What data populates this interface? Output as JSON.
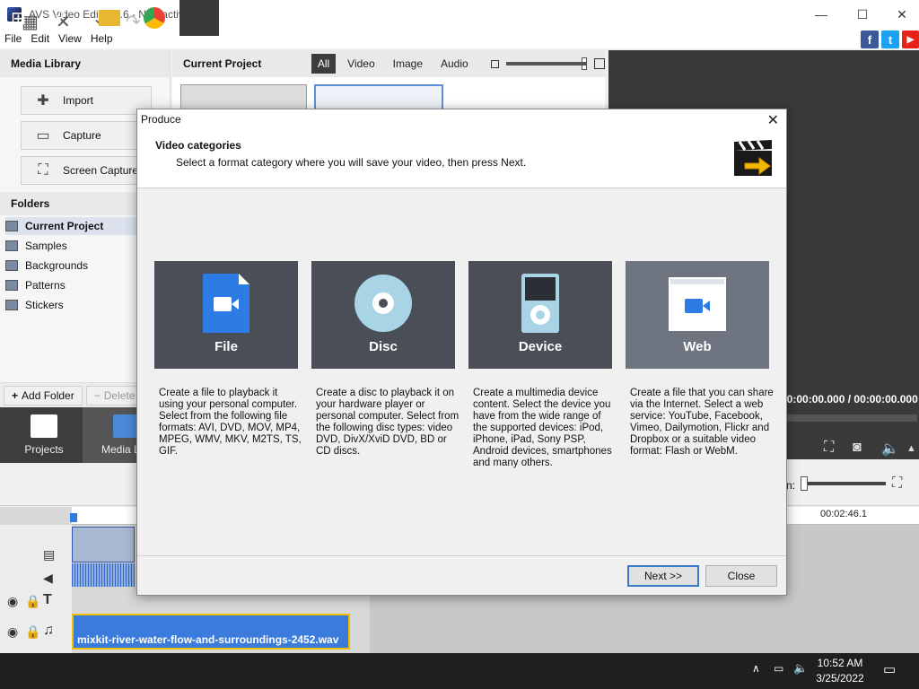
{
  "window": {
    "title": "AVS Video Editor 9.6 - Non-activated",
    "minimize": "—",
    "maximize": "☐",
    "close": "✕"
  },
  "menu": [
    "File",
    "Edit",
    "View",
    "Help"
  ],
  "social": {
    "facebook": "f",
    "twitter": "t",
    "youtube": "▶"
  },
  "media_library": {
    "title": "Media Library",
    "buttons": {
      "import": "Import",
      "capture": "Capture",
      "screen_capture": "Screen Capture"
    },
    "folders_title": "Folders",
    "folders": [
      "Current Project",
      "Samples",
      "Backgrounds",
      "Patterns",
      "Stickers"
    ],
    "add_folder": "Add Folder",
    "delete": "Delete"
  },
  "current_project": {
    "title": "Current Project",
    "filters": [
      "All",
      "Video",
      "Image",
      "Audio"
    ]
  },
  "preview": {
    "time": "00:00:00.000 / 00:00:00.000"
  },
  "nav": {
    "projects": "Projects",
    "media_library": "Media Libr"
  },
  "timeline": {
    "time_marker": "00:02:46.1",
    "zoom_label": "n:",
    "audio_clip": "mixkit-river-water-flow-and-surroundings-2452.wav"
  },
  "taskbar": {
    "time": "10:52 AM",
    "date": "3/25/2022"
  },
  "dialog": {
    "title": "Produce",
    "close": "✕",
    "heading": "Video categories",
    "subheading": "Select a format category where you will save your video, then press Next.",
    "categories": [
      {
        "name": "File",
        "desc": "Create a file to playback it using your personal computer. Select from the following file formats: AVI, DVD, MOV, MP4, MPEG, WMV, MKV, M2TS, TS, GIF."
      },
      {
        "name": "Disc",
        "desc": "Create a disc to playback it on your hardware player or personal computer. Select from the following disc types: video DVD, DivX/XviD DVD, BD or CD discs."
      },
      {
        "name": "Device",
        "desc": "Create a multimedia device content. Select the device you have from the wide range of the supported devices: iPod, iPhone, iPad, Sony PSP, Android devices, smartphones and many others."
      },
      {
        "name": "Web",
        "desc": "Create a file that you can share via the Internet. Select a web service: YouTube, Facebook, Vimeo, Dailymotion, Flickr and Dropbox or a suitable video format: Flash or WebM."
      }
    ],
    "next": "Next >>",
    "close_button": "Close"
  },
  "colors": {
    "accent": "#2d7be5",
    "dark": "#3d3d3d",
    "card": "#4a4f57",
    "card_selected": "#6e7480"
  }
}
